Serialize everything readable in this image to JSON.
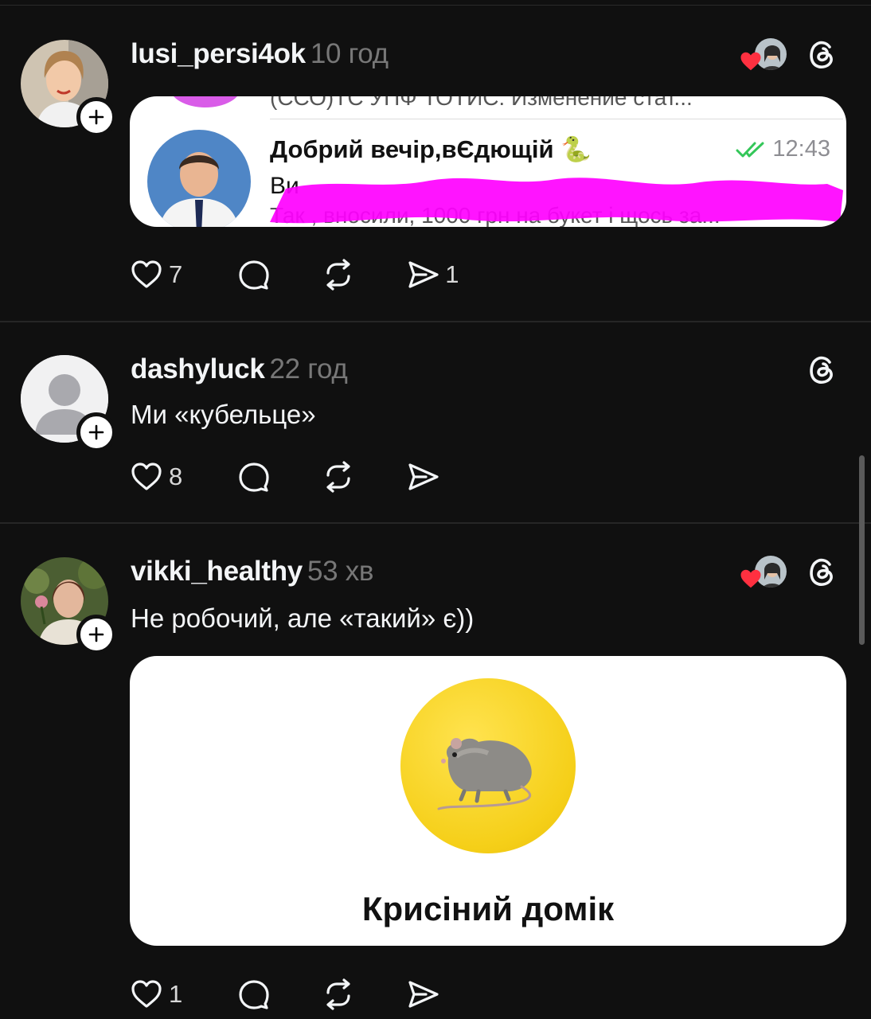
{
  "posts": [
    {
      "username": "lusi_persi4ok",
      "time": "10 год",
      "likes": "7",
      "reposts_shares": "1",
      "embed": {
        "top_snippet": "(ССО)ТС УПФ ТОТИС: Изменение стат...",
        "chat_title": "Добрий вечір,вЄдющій 🐍",
        "chat_time": "12:43",
        "chat_sender": "Ви",
        "chat_preview": "Так , вносили, 1000 грн на букет і щось за..."
      }
    },
    {
      "username": "dashyluck",
      "time": "22 год",
      "text": "Ми «кубельце»",
      "likes": "8"
    },
    {
      "username": "vikki_healthy",
      "time": "53 хв",
      "text": "Не робочий, але «такий» є))",
      "likes": "1",
      "embed": {
        "title": "Крисіний домік",
        "emoji": "🐀"
      }
    }
  ],
  "icons": [
    "plus-icon",
    "threads-icon",
    "heart-icon",
    "comment-icon",
    "repost-icon",
    "share-icon",
    "check-icon"
  ],
  "colors": {
    "background": "#101010",
    "liked_heart": "#ff3040",
    "highlight": "#ff00ff",
    "check": "#34c759",
    "badge_yellow": "#f5cf18"
  }
}
